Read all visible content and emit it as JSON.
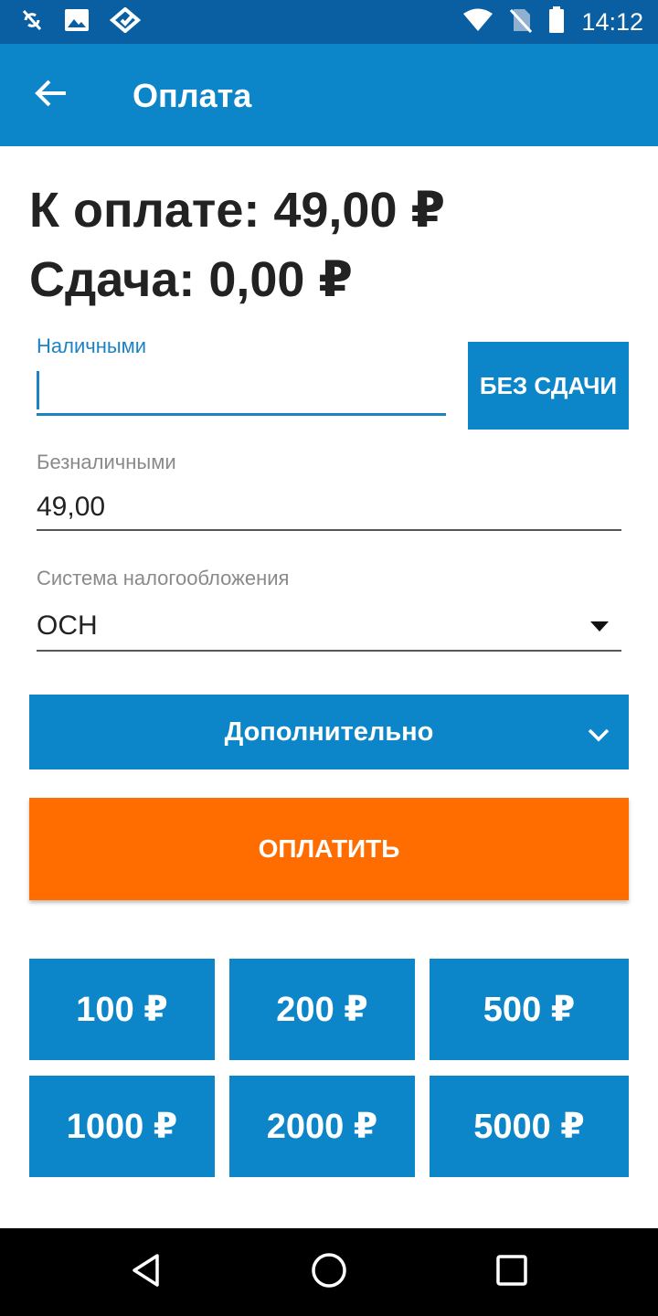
{
  "status_bar": {
    "time": "14:12",
    "icons_left": [
      "sync-off-icon",
      "image-icon",
      "diamond-app-icon"
    ],
    "icons_right": [
      "wifi-icon",
      "no-sim-icon",
      "battery-icon"
    ]
  },
  "app_bar": {
    "title": "Оплата",
    "back_icon": "arrow-left-icon"
  },
  "summary": {
    "amount_due": "К оплате: 49,00 ₽",
    "change": "Сдача: 0,00 ₽"
  },
  "cash_field": {
    "label": "Наличными",
    "value": ""
  },
  "no_change_button": "БЕЗ СДАЧИ",
  "card_field": {
    "label": "Безналичными",
    "value": "49,00"
  },
  "tax_field": {
    "label": "Система налогообложения",
    "value": "ОСН"
  },
  "more_button": "Дополнительно",
  "pay_button": "ОПЛАТИТЬ",
  "quick_amounts": [
    "100 ₽",
    "200 ₽",
    "500 ₽",
    "1000 ₽",
    "2000 ₽",
    "5000 ₽"
  ],
  "colors": {
    "status_bar": "#0a5fa3",
    "app_bar": "#0d86c9",
    "accent_blue": "#0d86c9",
    "pay_orange": "#ff6d00"
  }
}
